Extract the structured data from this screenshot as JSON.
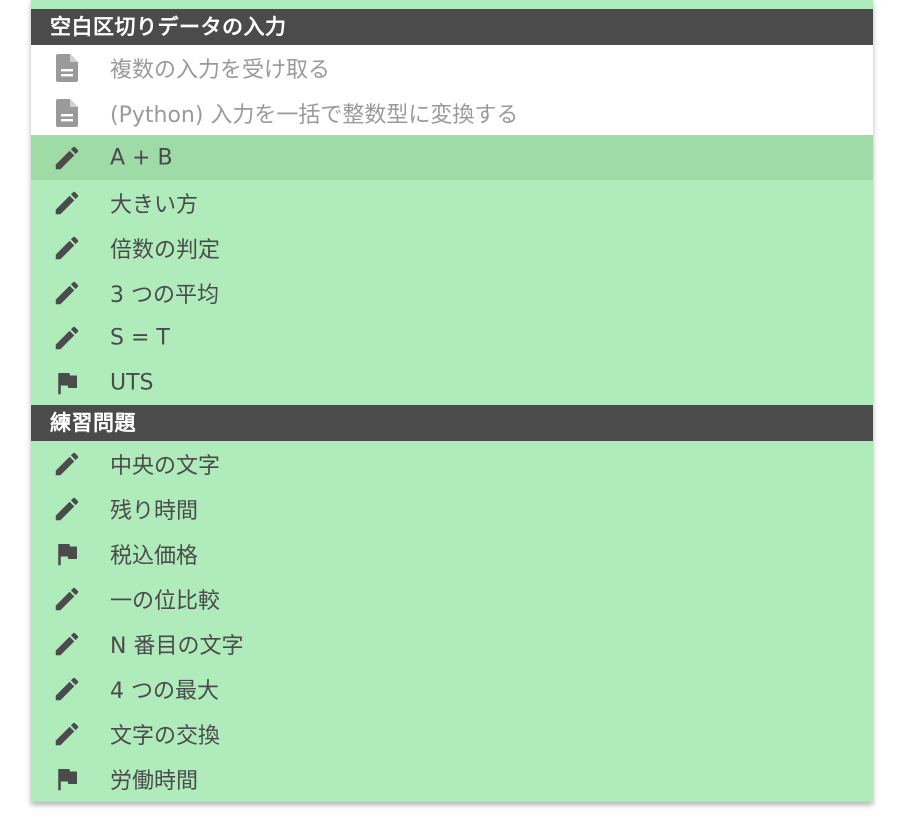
{
  "colors": {
    "panel_bg": "#b0ebbb",
    "selected_bg": "#9edba7",
    "header_bg": "#4b4b4b",
    "header_text": "#ffffff",
    "item_text": "#4b4b4b",
    "doc_bg": "#ffffff",
    "doc_text": "#9a9a9a"
  },
  "sections": [
    {
      "title": "空白区切りデータの入力",
      "items": [
        {
          "label": "複数の入力を受け取る",
          "icon": "document-icon",
          "type": "doc"
        },
        {
          "label": "(Python) 入力を一括で整数型に変換する",
          "icon": "document-icon",
          "type": "doc"
        },
        {
          "label": "A + B",
          "icon": "pencil-icon",
          "type": "exercise",
          "selected": true
        },
        {
          "label": "大きい方",
          "icon": "pencil-icon",
          "type": "exercise"
        },
        {
          "label": "倍数の判定",
          "icon": "pencil-icon",
          "type": "exercise"
        },
        {
          "label": "3 つの平均",
          "icon": "pencil-icon",
          "type": "exercise"
        },
        {
          "label": "S = T",
          "icon": "pencil-icon",
          "type": "exercise"
        },
        {
          "label": "UTS",
          "icon": "flag-icon",
          "type": "final"
        }
      ]
    },
    {
      "title": "練習問題",
      "items": [
        {
          "label": "中央の文字",
          "icon": "pencil-icon",
          "type": "exercise"
        },
        {
          "label": "残り時間",
          "icon": "pencil-icon",
          "type": "exercise"
        },
        {
          "label": "税込価格",
          "icon": "flag-icon",
          "type": "final"
        },
        {
          "label": "一の位比較",
          "icon": "pencil-icon",
          "type": "exercise"
        },
        {
          "label": "N 番目の文字",
          "icon": "pencil-icon",
          "type": "exercise"
        },
        {
          "label": "4 つの最大",
          "icon": "pencil-icon",
          "type": "exercise"
        },
        {
          "label": "文字の交換",
          "icon": "pencil-icon",
          "type": "exercise"
        },
        {
          "label": "労働時間",
          "icon": "flag-icon",
          "type": "final"
        }
      ]
    }
  ]
}
